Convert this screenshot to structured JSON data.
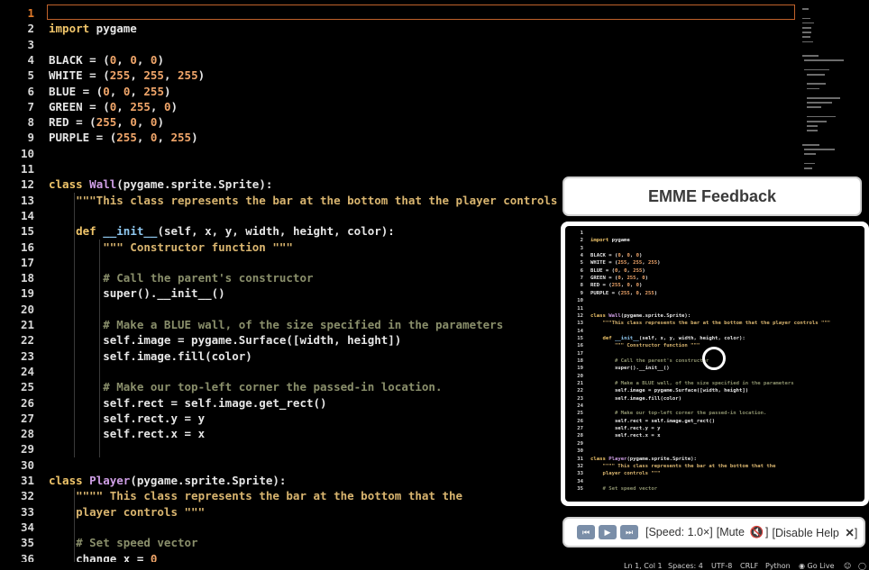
{
  "editor": {
    "lines": [
      {
        "n": "1",
        "t": ""
      },
      {
        "n": "2",
        "t": "import pygame"
      },
      {
        "n": "3",
        "t": ""
      },
      {
        "n": "4",
        "t": "BLACK = (0, 0, 0)"
      },
      {
        "n": "5",
        "t": "WHITE = (255, 255, 255)"
      },
      {
        "n": "6",
        "t": "BLUE = (0, 0, 255)"
      },
      {
        "n": "7",
        "t": "GREEN = (0, 255, 0)"
      },
      {
        "n": "8",
        "t": "RED = (255, 0, 0)"
      },
      {
        "n": "9",
        "t": "PURPLE = (255, 0, 255)"
      },
      {
        "n": "10",
        "t": ""
      },
      {
        "n": "11",
        "t": ""
      },
      {
        "n": "12",
        "t": "class Wall(pygame.sprite.Sprite):"
      },
      {
        "n": "13",
        "t": "    \"\"\"This class represents the bar at the bottom that the player controls \"\"\""
      },
      {
        "n": "14",
        "t": ""
      },
      {
        "n": "15",
        "t": "    def __init__(self, x, y, width, height, color):"
      },
      {
        "n": "16",
        "t": "        \"\"\" Constructor function \"\"\""
      },
      {
        "n": "17",
        "t": ""
      },
      {
        "n": "18",
        "t": "        # Call the parent's constructor"
      },
      {
        "n": "19",
        "t": "        super().__init__()"
      },
      {
        "n": "20",
        "t": ""
      },
      {
        "n": "21",
        "t": "        # Make a BLUE wall, of the size specified in the parameters"
      },
      {
        "n": "22",
        "t": "        self.image = pygame.Surface([width, height])"
      },
      {
        "n": "23",
        "t": "        self.image.fill(color)"
      },
      {
        "n": "24",
        "t": ""
      },
      {
        "n": "25",
        "t": "        # Make our top-left corner the passed-in location."
      },
      {
        "n": "26",
        "t": "        self.rect = self.image.get_rect()"
      },
      {
        "n": "27",
        "t": "        self.rect.y = y"
      },
      {
        "n": "28",
        "t": "        self.rect.x = x"
      },
      {
        "n": "29",
        "t": ""
      },
      {
        "n": "30",
        "t": ""
      },
      {
        "n": "31",
        "t": "class Player(pygame.sprite.Sprite):"
      },
      {
        "n": "32",
        "t": "    \"\"\"\" This class represents the bar at the bottom that the"
      },
      {
        "n": "33",
        "t": "    player controls \"\"\""
      },
      {
        "n": "34",
        "t": ""
      },
      {
        "n": "35",
        "t": "    # Set speed vector"
      },
      {
        "n": "36",
        "t": "    change_x = 0"
      }
    ]
  },
  "feedback": {
    "title": "EMME Feedback"
  },
  "controls": {
    "rewind_icon": "rewind-icon",
    "play_icon": "play-icon",
    "forward_icon": "fast-forward-icon",
    "speed_text": "[Speed: 1.0×]",
    "mute_text": "[Mute",
    "mute_close": "]",
    "help_text": "[Disable Help",
    "help_close": "]"
  },
  "statusbar": {
    "position": "Ln 1, Col 1",
    "spaces": "Spaces: 4",
    "encoding": "UTF-8",
    "eol": "CRLF",
    "language": "Python",
    "golive": "Go Live"
  },
  "colors": {
    "background": "#000000",
    "current_line_border": "#c0622b",
    "keyword": "#f0c56a",
    "class_name": "#cf9fe6",
    "comment": "#8a8f6b",
    "control_button": "#7a8ea8",
    "mute_icon": "#c0392b"
  }
}
